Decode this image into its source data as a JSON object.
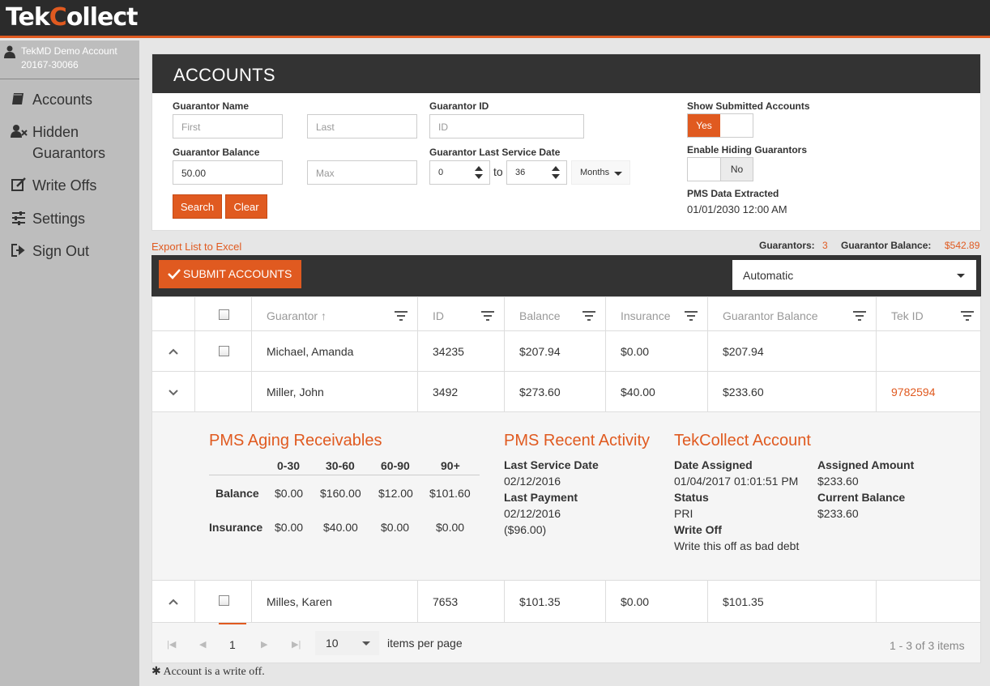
{
  "app": {
    "logo_a": "Tek",
    "logo_b": "C",
    "logo_c": "ollect"
  },
  "account": {
    "name": "TekMD Demo Account",
    "id": "20167-30066"
  },
  "nav": [
    {
      "label": "Accounts",
      "icon": "book-icon"
    },
    {
      "label": "Hidden",
      "label2": "Guarantors",
      "icon": "user-hide-icon"
    },
    {
      "label": "Write Offs",
      "icon": "edit-icon"
    },
    {
      "label": "Settings",
      "icon": "sliders-icon"
    },
    {
      "label": "Sign Out",
      "icon": "sign-out-icon"
    }
  ],
  "panel": {
    "title": "ACCOUNTS",
    "guarantor_name_label": "Guarantor Name",
    "first_placeholder": "First",
    "last_placeholder": "Last",
    "guarantor_id_label": "Guarantor ID",
    "id_placeholder": "ID",
    "balance_label": "Guarantor Balance",
    "balance_min": "50.00",
    "max_placeholder": "Max",
    "last_service_label": "Guarantor Last Service Date",
    "service_from": "0",
    "service_to_word": "to",
    "service_to": "36",
    "service_unit": "Months",
    "search_label": "Search",
    "clear_label": "Clear",
    "show_submitted_label": "Show Submitted Accounts",
    "show_submitted_value": "Yes",
    "enable_hiding_label": "Enable Hiding Guarantors",
    "enable_hiding_value": "No",
    "pms_extracted_label": "PMS Data Extracted",
    "pms_extracted_value": "01/01/2030 12:00 AM"
  },
  "summary": {
    "export_label": "Export List to Excel",
    "guarantors_label": "Guarantors:",
    "guarantors_count": "3",
    "balance_label": "Guarantor Balance:",
    "balance_value": "$542.89"
  },
  "toolbar": {
    "submit_label": "SUBMIT ACCOUNTS",
    "mode_value": "Automatic"
  },
  "grid": {
    "columns": [
      "Guarantor",
      "ID",
      "Balance",
      "Insurance",
      "Guarantor Balance",
      "Tek ID"
    ],
    "sort_indicator": "↑",
    "rows": [
      {
        "guarantor": "Michael, Amanda",
        "id": "34235",
        "balance": "$207.94",
        "insurance": "$0.00",
        "guarantor_balance": "$207.94",
        "tek_id": ""
      },
      {
        "guarantor": "Miller, John",
        "id": "3492",
        "balance": "$273.60",
        "insurance": "$40.00",
        "guarantor_balance": "$233.60",
        "tek_id": "9782594"
      },
      {
        "guarantor": "Milles, Karen",
        "id": "7653",
        "balance": "$101.35",
        "insurance": "$0.00",
        "guarantor_balance": "$101.35",
        "tek_id": ""
      }
    ]
  },
  "detail": {
    "aging_title": "PMS Aging Receivables",
    "aging_headers": [
      "0-30",
      "30-60",
      "60-90",
      "90+"
    ],
    "aging_rows": [
      {
        "label": "Balance",
        "values": [
          "$0.00",
          "$160.00",
          "$12.00",
          "$101.60"
        ]
      },
      {
        "label": "Insurance",
        "values": [
          "$0.00",
          "$40.00",
          "$0.00",
          "$0.00"
        ]
      }
    ],
    "activity_title": "PMS Recent Activity",
    "last_service_label": "Last Service Date",
    "last_service_value": "02/12/2016",
    "last_payment_label": "Last Payment",
    "last_payment_date": "02/12/2016",
    "last_payment_amount": "($96.00)",
    "tek_title": "TekCollect Account",
    "date_assigned_label": "Date Assigned",
    "date_assigned_value": "01/04/2017 01:01:51 PM",
    "status_label": "Status",
    "status_value": "PRI",
    "write_off_label": "Write Off",
    "write_off_link": "Write this off as bad debt",
    "assigned_amount_label": "Assigned Amount",
    "assigned_amount_value": "$233.60",
    "current_balance_label": "Current Balance",
    "current_balance_value": "$233.60"
  },
  "pager": {
    "current_page": "1",
    "page_size": "10",
    "per_page_label": "items per page",
    "range_label": "1 - 3 of 3 items"
  },
  "footer": {
    "note": "Account is a write off."
  },
  "colors": {
    "accent": "#e05a20",
    "dark": "#333333",
    "sidebar": "#bdbdbd"
  }
}
